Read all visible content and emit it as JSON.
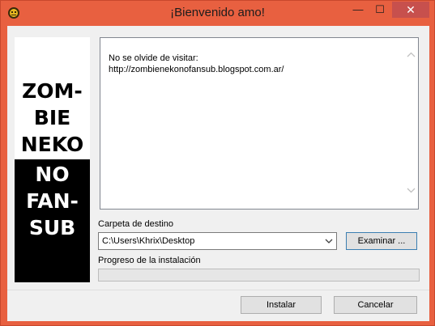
{
  "window": {
    "title": "¡Bienvenido amo!",
    "min_label": "—",
    "max_label": "☐",
    "close_label": "✕",
    "icon": "app-icon",
    "accent_color": "#e86040"
  },
  "banner": {
    "top_lines": [
      "ZOM-",
      "BIE",
      "NEKO"
    ],
    "bottom_lines": [
      "NO",
      "FAN-",
      "SUB"
    ]
  },
  "message": {
    "line1": "No se olvide de visitar:",
    "line2": "http://zombienekonofansub.blogspot.com.ar/"
  },
  "destination": {
    "label": "Carpeta de destino",
    "value": "C:\\Users\\Khrix\\Desktop",
    "browse_label": "Examinar ..."
  },
  "progress": {
    "label": "Progreso de la instalación",
    "value": 0
  },
  "footer": {
    "install_label": "Instalar",
    "cancel_label": "Cancelar"
  }
}
